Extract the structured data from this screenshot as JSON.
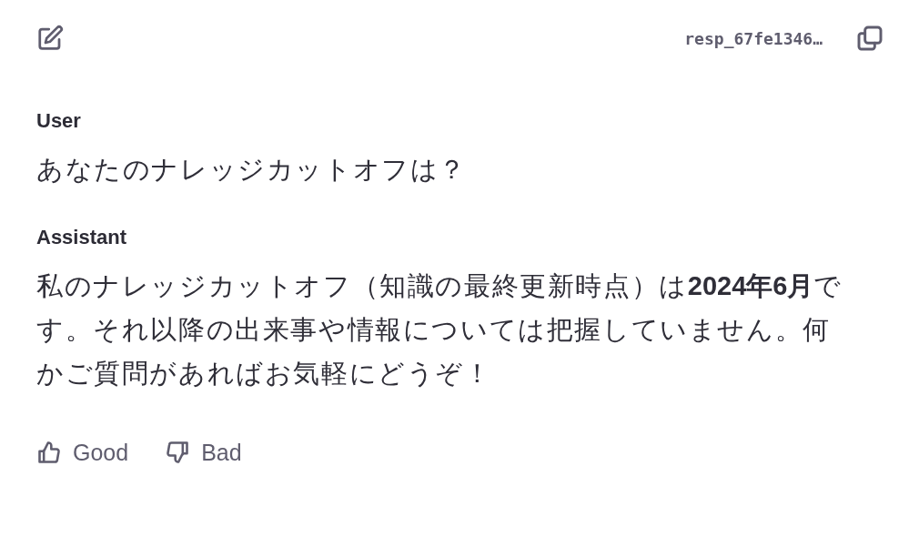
{
  "header": {
    "response_id": "resp_67fe1346…"
  },
  "messages": [
    {
      "role": "User",
      "text": "あなたのナレッジカットオフは？"
    },
    {
      "role": "Assistant",
      "text": "私のナレッジカットオフ（知識の最終更新時点）は**2024年6月**です。それ以降の出来事や情報については把握していません。何かご質問があればお気軽にどうぞ！"
    }
  ],
  "feedback": [
    {
      "kind": "good",
      "label": "Good"
    },
    {
      "kind": "bad",
      "label": "Bad"
    }
  ]
}
